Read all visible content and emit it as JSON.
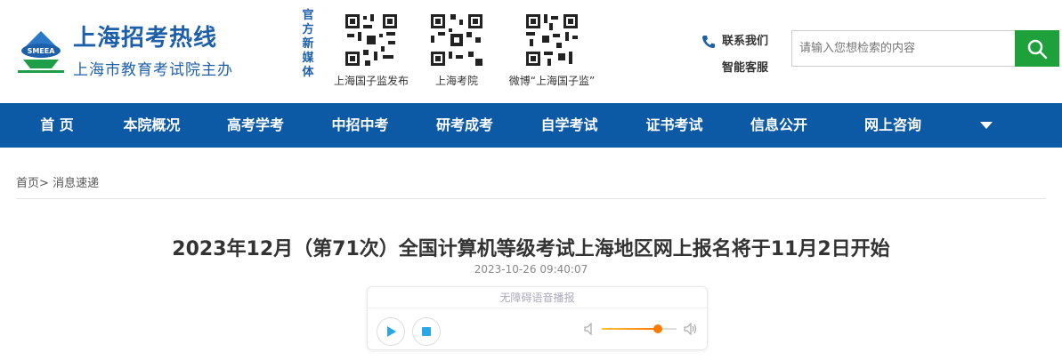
{
  "header": {
    "logo_title": "上海招考热线",
    "logo_subtitle": "上海市教育考试院主办",
    "logo_badge": "SMEEA",
    "media_label": "官方新媒体",
    "qr_codes": [
      {
        "caption": "上海国子监发布"
      },
      {
        "caption": "上海考院"
      },
      {
        "caption": "微博“上海国子监”"
      }
    ],
    "contact_label": "联系我们",
    "service_label": "智能客服",
    "search_placeholder": "请输入您想检索的内容"
  },
  "nav": {
    "items": [
      "首 页",
      "本院概况",
      "高考学考",
      "中招中考",
      "研考成考",
      "自学考试",
      "证书考试",
      "信息公开",
      "网上咨询"
    ]
  },
  "breadcrumb": {
    "home": "首页",
    "separator": ">",
    "current": "消息速递"
  },
  "article": {
    "title": "2023年12月（第71次）全国计算机等级考试上海地区网上报名将于11月2日开始",
    "date": "2023-10-26 09:40:07"
  },
  "player": {
    "label": "无障碍语音播报",
    "volume": 0.75
  },
  "colors": {
    "brand_blue": "#1d5fa8",
    "nav_blue": "#0c5aa6",
    "search_green": "#1ea03a",
    "volume_orange": "#ff7a00"
  }
}
